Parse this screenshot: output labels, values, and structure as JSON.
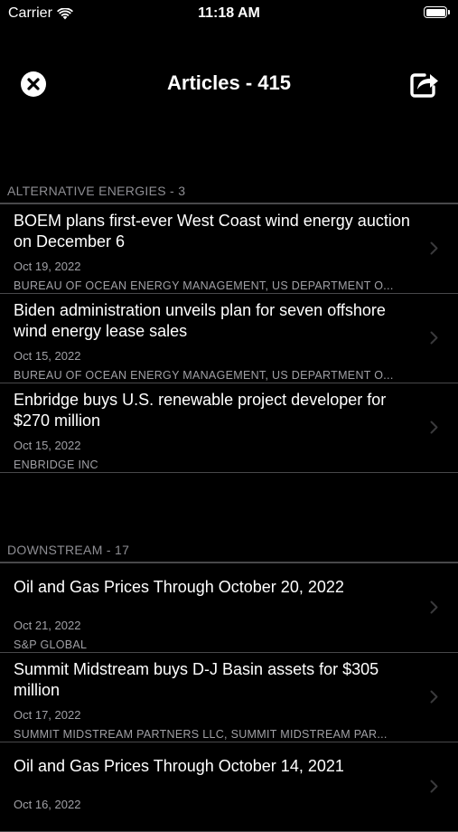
{
  "status_bar": {
    "carrier": "Carrier",
    "time": "11:18 AM"
  },
  "nav": {
    "title": "Articles - 415",
    "close_icon": "close-circle-icon",
    "share_icon": "share-icon"
  },
  "sections": [
    {
      "header": "ALTERNATIVE ENERGIES - 3",
      "articles": [
        {
          "title": "BOEM plans first-ever West Coast wind energy auction on December 6",
          "date": "Oct 19, 2022",
          "source": "BUREAU OF OCEAN ENERGY MANAGEMENT, US DEPARTMENT O..."
        },
        {
          "title": "Biden administration unveils plan for seven offshore wind energy lease sales",
          "date": "Oct 15, 2022",
          "source": "BUREAU OF OCEAN ENERGY MANAGEMENT, US DEPARTMENT O..."
        },
        {
          "title": "Enbridge buys U.S. renewable project developer for $270 million",
          "date": "Oct 15, 2022",
          "source": "ENBRIDGE INC"
        }
      ]
    },
    {
      "header": "DOWNSTREAM - 17",
      "articles": [
        {
          "title": "Oil and Gas Prices Through October 20, 2022",
          "date": "Oct 21, 2022",
          "source": "S&P GLOBAL"
        },
        {
          "title": "Summit Midstream buys D-J Basin assets for $305 million",
          "date": "Oct 17, 2022",
          "source": "SUMMIT MIDSTREAM PARTNERS LLC, SUMMIT MIDSTREAM PAR..."
        },
        {
          "title": "Oil and Gas Prices Through October 14, 2021",
          "date": "Oct 16, 2022",
          "source": ""
        }
      ]
    }
  ]
}
